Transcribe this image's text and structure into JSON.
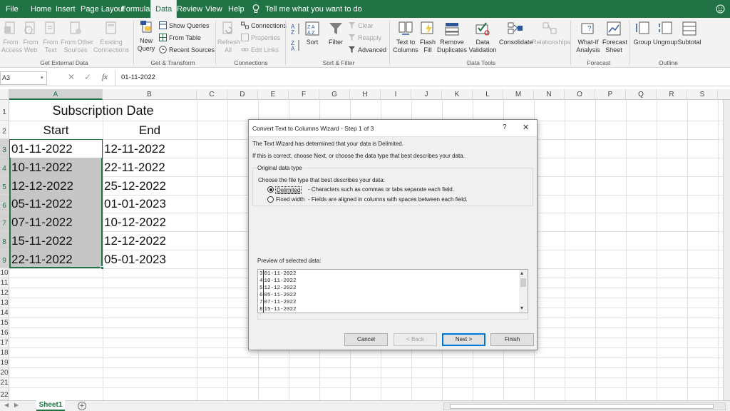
{
  "menu": {
    "tabs": [
      "File",
      "Home",
      "Insert",
      "Page Layout",
      "Formulas",
      "Data",
      "Review",
      "View",
      "Help"
    ],
    "tell_me": "Tell me what you want to do"
  },
  "ribbon": {
    "get_external": {
      "from_access": "From\nAccess",
      "from_web": "From\nWeb",
      "from_text": "From\nText",
      "from_other": "From Other\nSources",
      "existing": "Existing\nConnections",
      "label": "Get External Data"
    },
    "get_transform": {
      "new_query": "New\nQuery",
      "show_queries": "Show Queries",
      "from_table": "From Table",
      "recent_sources": "Recent Sources",
      "label": "Get & Transform"
    },
    "connections": {
      "refresh_all": "Refresh\nAll",
      "connections": "Connections",
      "properties": "Properties",
      "edit_links": "Edit Links",
      "label": "Connections"
    },
    "sort_filter": {
      "sort": "Sort",
      "filter": "Filter",
      "clear": "Clear",
      "reapply": "Reapply",
      "advanced": "Advanced",
      "label": "Sort & Filter"
    },
    "data_tools": {
      "text_to_columns": "Text to\nColumns",
      "flash_fill": "Flash\nFill",
      "remove_duplicates": "Remove\nDuplicates",
      "data_validation": "Data\nValidation",
      "consolidate": "Consolidate",
      "relationships": "Relationships",
      "label": "Data Tools"
    },
    "forecast": {
      "what_if": "What-If\nAnalysis",
      "forecast_sheet": "Forecast\nSheet",
      "label": "Forecast"
    },
    "outline": {
      "group": "Group",
      "ungroup": "Ungroup",
      "subtotal": "Subtotal",
      "label": "Outline"
    }
  },
  "formula_bar": {
    "name_box": "A3",
    "fx": "fx",
    "value": "01-11-2022"
  },
  "columns": [
    "A",
    "B",
    "C",
    "D",
    "E",
    "F",
    "G",
    "H",
    "I",
    "J",
    "K",
    "L",
    "M",
    "N",
    "O",
    "P",
    "Q",
    "R",
    "S"
  ],
  "rows": [
    "1",
    "2",
    "3",
    "4",
    "5",
    "6",
    "7",
    "8",
    "9",
    "10",
    "11",
    "12",
    "13",
    "14",
    "15",
    "16",
    "17",
    "18",
    "19",
    "20",
    "21",
    "22"
  ],
  "sheet": {
    "title": "Subscription Date",
    "header_start": "Start",
    "header_end": "End",
    "start_dates": [
      "01-11-2022",
      "10-11-2022",
      "12-12-2022",
      "05-11-2022",
      "07-11-2022",
      "15-11-2022",
      "22-11-2022"
    ],
    "end_dates": [
      "12-11-2022",
      "22-11-2022",
      "25-12-2022",
      "01-01-2023",
      "10-12-2022",
      "12-12-2022",
      "05-01-2023"
    ]
  },
  "sheet_tab": "Sheet1",
  "dialog": {
    "title": "Convert Text to Columns Wizard - Step 1 of 3",
    "help": "?",
    "close": "✕",
    "line1": "The Text Wizard has determined that your data is Delimited.",
    "line2": "If this is correct, choose Next, or choose the data type that best describes your data.",
    "group_label": "Original data type",
    "choose_label": "Choose the file type that best describes your data:",
    "delimited_label": "Delimited",
    "delimited_desc": "- Characters such as commas or tabs separate each field.",
    "fixed_label": "Fixed width",
    "fixed_desc": "- Fields are aligned in columns with spaces between each field.",
    "preview_label": "Preview of selected data:",
    "preview_rows": [
      {
        "num": "3",
        "text": "01-11-2022"
      },
      {
        "num": "4",
        "text": "10-11-2022"
      },
      {
        "num": "5",
        "text": "12-12-2022"
      },
      {
        "num": "6",
        "text": "05-11-2022"
      },
      {
        "num": "7",
        "text": "07-11-2022"
      },
      {
        "num": "8",
        "text": "15-11-2022"
      }
    ],
    "cancel": "Cancel",
    "back": "< Back",
    "next": "Next >",
    "finish": "Finish"
  },
  "colors": {
    "excel_green": "#217346",
    "selection_fill": "#c6c6c6",
    "accent_blue": "#0078d7"
  }
}
